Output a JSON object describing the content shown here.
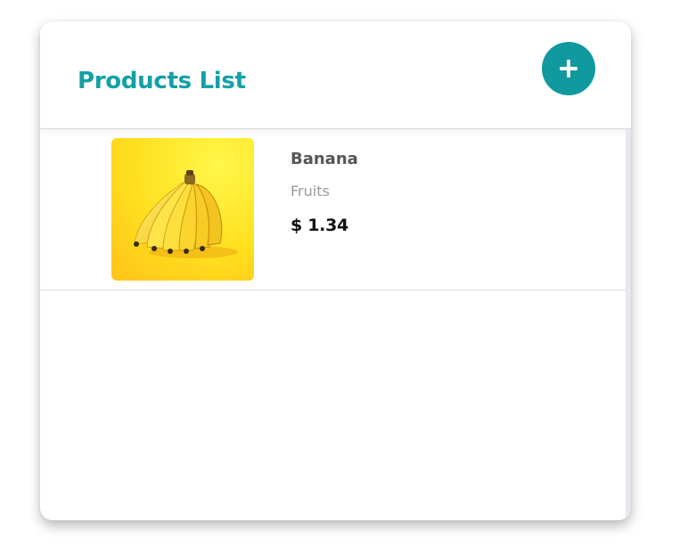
{
  "header": {
    "title": "Products List",
    "add_button_icon": "plus-icon"
  },
  "colors": {
    "accent": "#10999f",
    "title": "#13a0a6",
    "name_text": "#555555",
    "category_text": "#9a9a9a",
    "price_text": "#111111"
  },
  "products": [
    {
      "name": "Banana",
      "category": "Fruits",
      "price": "$ 1.34",
      "image": "banana-photo"
    }
  ]
}
